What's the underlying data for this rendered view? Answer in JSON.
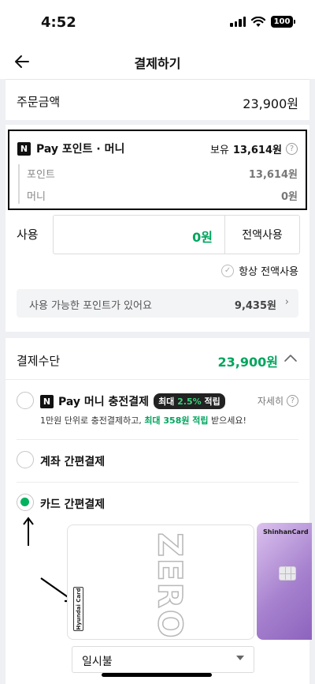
{
  "status": {
    "time": "4:52",
    "battery": "100"
  },
  "header": {
    "title": "결제하기"
  },
  "order": {
    "label": "주문금액",
    "amount": "23,900원"
  },
  "npay_point": {
    "logo_letter": "N",
    "title": "Pay 포인트 · 머니",
    "own_prefix": "보유",
    "own_amount": "13,614원",
    "point_label": "포인트",
    "point_amount": "13,614원",
    "money_label": "머니",
    "money_amount": "0원"
  },
  "use": {
    "label": "사용",
    "amount": "0원",
    "use_all_button": "전액사용",
    "always_use_all": "항상 전액사용",
    "available_text": "사용 가능한 포인트가 있어요",
    "available_amount": "9,435원"
  },
  "payment": {
    "title": "결제수단",
    "total": "23,900원",
    "npay_option": {
      "logo_letter": "N",
      "label": "Pay 머니 충전결제",
      "badge_prefix": "최대",
      "badge_value": "2.5%",
      "badge_suffix": "적립",
      "detail": "자세히",
      "desc_before": "1만원 단위로 충전결제하고, ",
      "desc_highlight": "최대 358원 적립",
      "desc_after": " 받으세요!"
    },
    "account_option": {
      "label": "계좌 간편결제"
    },
    "card_option": {
      "label": "카드 간편결제",
      "selected": true
    },
    "cards": {
      "hyundai_label": "Hyundai Card",
      "hyundai_product": "ZERO",
      "shinhan_label": "ShinhanCard"
    },
    "installment": {
      "value": "일시불"
    }
  },
  "colors": {
    "accent_green": "#00a55e",
    "radio_green": "#00b25e",
    "shinhan_purple": "#a782cf"
  }
}
